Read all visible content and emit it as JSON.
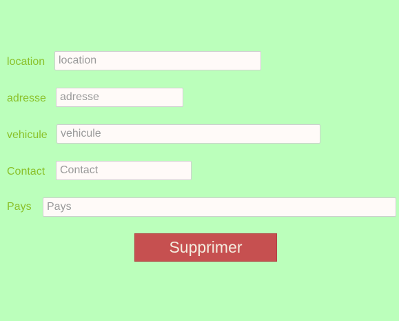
{
  "form": {
    "fields": [
      {
        "label": "location",
        "value": "",
        "placeholder": "location"
      },
      {
        "label": "adresse",
        "value": "",
        "placeholder": "adresse"
      },
      {
        "label": "vehicule",
        "value": "",
        "placeholder": "vehicule"
      },
      {
        "label": "Contact",
        "value": "",
        "placeholder": "Contact"
      },
      {
        "label": "Pays",
        "value": "",
        "placeholder": "Pays"
      }
    ],
    "delete_label": "Supprimer"
  },
  "colors": {
    "background": "#bbffbb",
    "label_text": "#8ac12a",
    "input_background": "#fffaf8",
    "button_background": "#c65050",
    "button_text": "#f4ecdf"
  }
}
